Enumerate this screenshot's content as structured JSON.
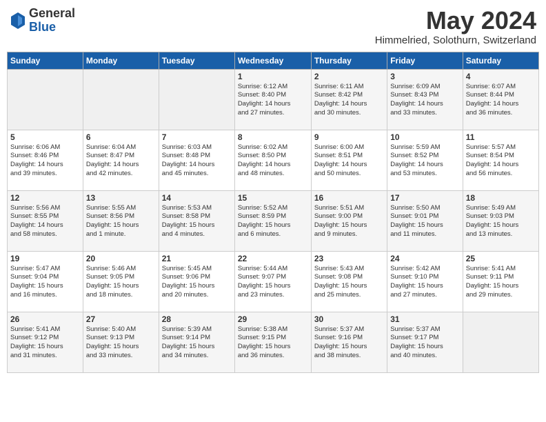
{
  "header": {
    "logo_general": "General",
    "logo_blue": "Blue",
    "month_year": "May 2024",
    "location": "Himmelried, Solothurn, Switzerland"
  },
  "days_of_week": [
    "Sunday",
    "Monday",
    "Tuesday",
    "Wednesday",
    "Thursday",
    "Friday",
    "Saturday"
  ],
  "weeks": [
    [
      {
        "day": "",
        "content": ""
      },
      {
        "day": "",
        "content": ""
      },
      {
        "day": "",
        "content": ""
      },
      {
        "day": "1",
        "content": "Sunrise: 6:12 AM\nSunset: 8:40 PM\nDaylight: 14 hours\nand 27 minutes."
      },
      {
        "day": "2",
        "content": "Sunrise: 6:11 AM\nSunset: 8:42 PM\nDaylight: 14 hours\nand 30 minutes."
      },
      {
        "day": "3",
        "content": "Sunrise: 6:09 AM\nSunset: 8:43 PM\nDaylight: 14 hours\nand 33 minutes."
      },
      {
        "day": "4",
        "content": "Sunrise: 6:07 AM\nSunset: 8:44 PM\nDaylight: 14 hours\nand 36 minutes."
      }
    ],
    [
      {
        "day": "5",
        "content": "Sunrise: 6:06 AM\nSunset: 8:46 PM\nDaylight: 14 hours\nand 39 minutes."
      },
      {
        "day": "6",
        "content": "Sunrise: 6:04 AM\nSunset: 8:47 PM\nDaylight: 14 hours\nand 42 minutes."
      },
      {
        "day": "7",
        "content": "Sunrise: 6:03 AM\nSunset: 8:48 PM\nDaylight: 14 hours\nand 45 minutes."
      },
      {
        "day": "8",
        "content": "Sunrise: 6:02 AM\nSunset: 8:50 PM\nDaylight: 14 hours\nand 48 minutes."
      },
      {
        "day": "9",
        "content": "Sunrise: 6:00 AM\nSunset: 8:51 PM\nDaylight: 14 hours\nand 50 minutes."
      },
      {
        "day": "10",
        "content": "Sunrise: 5:59 AM\nSunset: 8:52 PM\nDaylight: 14 hours\nand 53 minutes."
      },
      {
        "day": "11",
        "content": "Sunrise: 5:57 AM\nSunset: 8:54 PM\nDaylight: 14 hours\nand 56 minutes."
      }
    ],
    [
      {
        "day": "12",
        "content": "Sunrise: 5:56 AM\nSunset: 8:55 PM\nDaylight: 14 hours\nand 58 minutes."
      },
      {
        "day": "13",
        "content": "Sunrise: 5:55 AM\nSunset: 8:56 PM\nDaylight: 15 hours\nand 1 minute."
      },
      {
        "day": "14",
        "content": "Sunrise: 5:53 AM\nSunset: 8:58 PM\nDaylight: 15 hours\nand 4 minutes."
      },
      {
        "day": "15",
        "content": "Sunrise: 5:52 AM\nSunset: 8:59 PM\nDaylight: 15 hours\nand 6 minutes."
      },
      {
        "day": "16",
        "content": "Sunrise: 5:51 AM\nSunset: 9:00 PM\nDaylight: 15 hours\nand 9 minutes."
      },
      {
        "day": "17",
        "content": "Sunrise: 5:50 AM\nSunset: 9:01 PM\nDaylight: 15 hours\nand 11 minutes."
      },
      {
        "day": "18",
        "content": "Sunrise: 5:49 AM\nSunset: 9:03 PM\nDaylight: 15 hours\nand 13 minutes."
      }
    ],
    [
      {
        "day": "19",
        "content": "Sunrise: 5:47 AM\nSunset: 9:04 PM\nDaylight: 15 hours\nand 16 minutes."
      },
      {
        "day": "20",
        "content": "Sunrise: 5:46 AM\nSunset: 9:05 PM\nDaylight: 15 hours\nand 18 minutes."
      },
      {
        "day": "21",
        "content": "Sunrise: 5:45 AM\nSunset: 9:06 PM\nDaylight: 15 hours\nand 20 minutes."
      },
      {
        "day": "22",
        "content": "Sunrise: 5:44 AM\nSunset: 9:07 PM\nDaylight: 15 hours\nand 23 minutes."
      },
      {
        "day": "23",
        "content": "Sunrise: 5:43 AM\nSunset: 9:08 PM\nDaylight: 15 hours\nand 25 minutes."
      },
      {
        "day": "24",
        "content": "Sunrise: 5:42 AM\nSunset: 9:10 PM\nDaylight: 15 hours\nand 27 minutes."
      },
      {
        "day": "25",
        "content": "Sunrise: 5:41 AM\nSunset: 9:11 PM\nDaylight: 15 hours\nand 29 minutes."
      }
    ],
    [
      {
        "day": "26",
        "content": "Sunrise: 5:41 AM\nSunset: 9:12 PM\nDaylight: 15 hours\nand 31 minutes."
      },
      {
        "day": "27",
        "content": "Sunrise: 5:40 AM\nSunset: 9:13 PM\nDaylight: 15 hours\nand 33 minutes."
      },
      {
        "day": "28",
        "content": "Sunrise: 5:39 AM\nSunset: 9:14 PM\nDaylight: 15 hours\nand 34 minutes."
      },
      {
        "day": "29",
        "content": "Sunrise: 5:38 AM\nSunset: 9:15 PM\nDaylight: 15 hours\nand 36 minutes."
      },
      {
        "day": "30",
        "content": "Sunrise: 5:37 AM\nSunset: 9:16 PM\nDaylight: 15 hours\nand 38 minutes."
      },
      {
        "day": "31",
        "content": "Sunrise: 5:37 AM\nSunset: 9:17 PM\nDaylight: 15 hours\nand 40 minutes."
      },
      {
        "day": "",
        "content": ""
      }
    ]
  ]
}
